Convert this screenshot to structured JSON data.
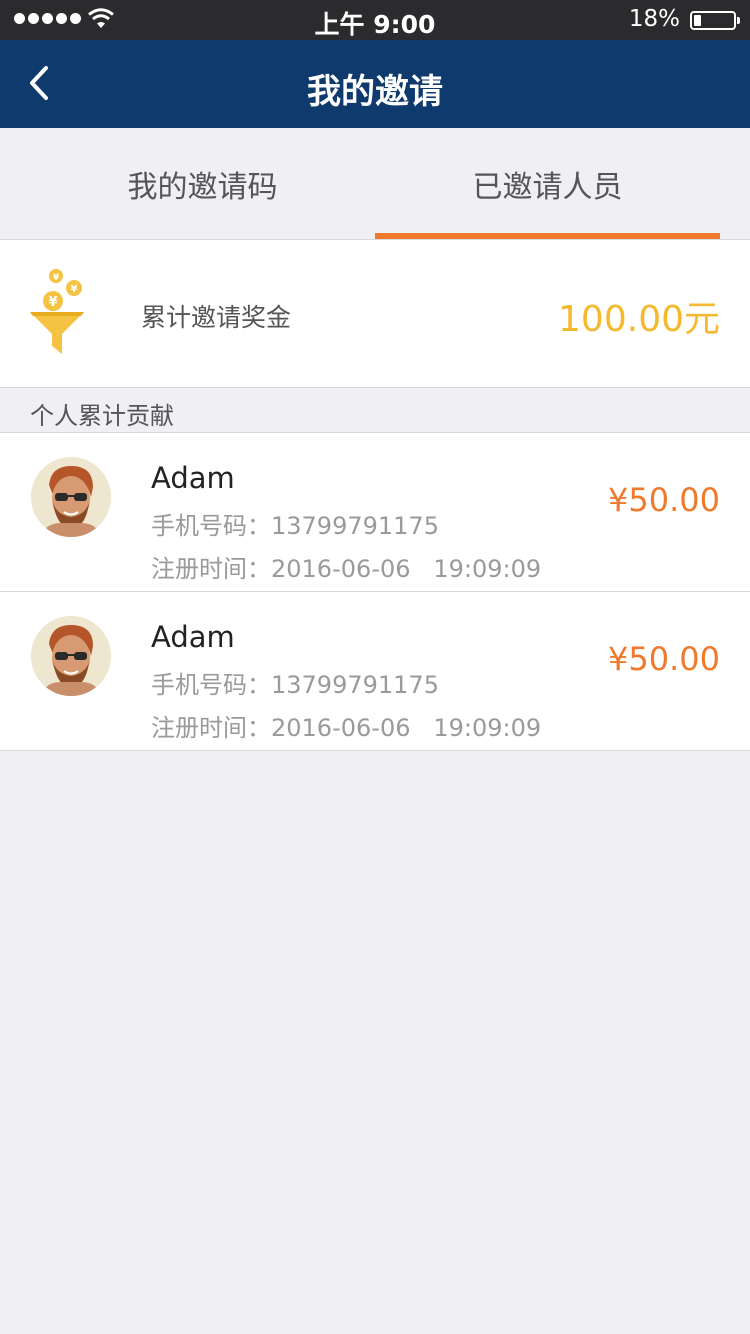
{
  "status_bar": {
    "time": "上午 9:00",
    "battery": "18%",
    "battery_level": 0.18
  },
  "nav": {
    "title": "我的邀请"
  },
  "tabs": [
    {
      "label": "我的邀请码",
      "active": false
    },
    {
      "label": "已邀请人员",
      "active": true
    }
  ],
  "bonus": {
    "label": "累计邀请奖金",
    "value": "100.00元"
  },
  "section": {
    "title": "个人累计贡献"
  },
  "phone_prefix": "手机号码：",
  "reg_prefix": "注册时间：",
  "invitees": [
    {
      "name": "Adam",
      "phone": "13799791175",
      "registered": "2016-06-06   19:09:09",
      "amount": "¥50.00"
    },
    {
      "name": "Adam",
      "phone": "13799791175",
      "registered": "2016-06-06   19:09:09",
      "amount": "¥50.00"
    }
  ],
  "colors": {
    "nav": "#0f3a6e",
    "accent": "#f07a2b",
    "bonus": "#f5b92e"
  }
}
